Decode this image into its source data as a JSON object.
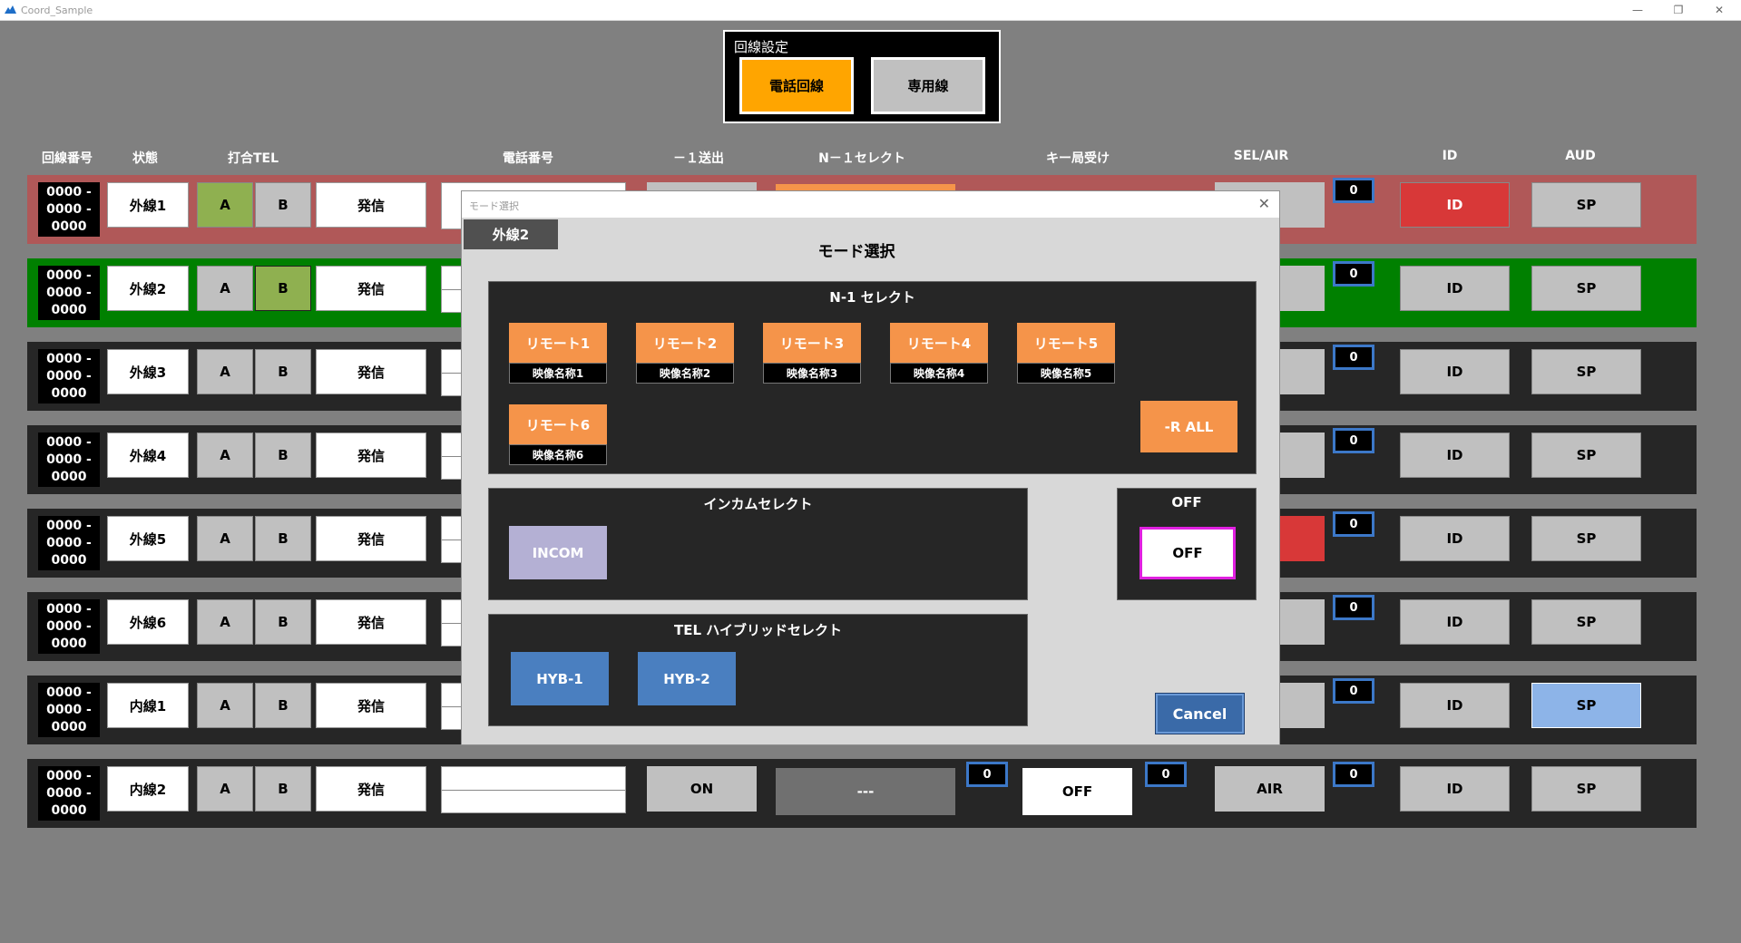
{
  "window": {
    "title": "Coord_Sample"
  },
  "line_setting": {
    "label": "回線設定",
    "phone_line": "電話回線",
    "dedicated_line": "専用線"
  },
  "columns": {
    "number": "回線番号",
    "status": "状態",
    "uchiawase": "打合TEL",
    "phone": "電話番号",
    "send": "－１送出",
    "n1": "N－１セレクト",
    "key": "キー局受け",
    "selair": "SEL/AIR",
    "id": "ID",
    "aud": "AUD"
  },
  "colors": {
    "row_selected": "#b05858",
    "row_active": "#008000",
    "row_default": "#262626",
    "accent_orange": "#ffa500"
  },
  "rows": [
    {
      "num": [
        "0000 -",
        "0000 -",
        "0000"
      ],
      "status": "外線1",
      "a": "A",
      "b": "B",
      "call": "発信",
      "id": "ID",
      "aud": "SP",
      "sq3": "0"
    },
    {
      "num": [
        "0000 -",
        "0000 -",
        "0000"
      ],
      "status": "外線2",
      "a": "A",
      "b": "B",
      "call": "発信",
      "id": "ID",
      "aud": "SP",
      "sq3": "0"
    },
    {
      "num": [
        "0000 -",
        "0000 -",
        "0000"
      ],
      "status": "外線3",
      "a": "A",
      "b": "B",
      "call": "発信",
      "id": "ID",
      "aud": "SP",
      "sq3": "0"
    },
    {
      "num": [
        "0000 -",
        "0000 -",
        "0000"
      ],
      "status": "外線4",
      "a": "A",
      "b": "B",
      "call": "発信",
      "id": "ID",
      "aud": "SP",
      "sq3": "0"
    },
    {
      "num": [
        "0000 -",
        "0000 -",
        "0000"
      ],
      "status": "外線5",
      "a": "A",
      "b": "B",
      "call": "発信",
      "id": "ID",
      "aud": "SP",
      "sq3": "0"
    },
    {
      "num": [
        "0000 -",
        "0000 -",
        "0000"
      ],
      "status": "外線6",
      "a": "A",
      "b": "B",
      "call": "発信",
      "id": "ID",
      "aud": "SP",
      "sq3": "0"
    },
    {
      "num": [
        "0000 -",
        "0000 -",
        "0000"
      ],
      "status": "内線1",
      "a": "A",
      "b": "B",
      "call": "発信",
      "id": "ID",
      "aud": "SP",
      "sq3": "0"
    },
    {
      "num": [
        "0000 -",
        "0000 -",
        "0000"
      ],
      "status": "内線2",
      "a": "A",
      "b": "B",
      "call": "発信",
      "send": "ON",
      "n1": "---",
      "sq1": "0",
      "key": "OFF",
      "sq2": "0",
      "selair": "AIR",
      "sq3": "0",
      "id": "ID",
      "aud": "SP"
    }
  ],
  "modal": {
    "window_title": "モード選択",
    "line_tag": "外線2",
    "heading": "モード選択",
    "n1_title": "N-1  セレクト",
    "remotes": [
      {
        "label": "リモート1",
        "video": "映像名称1"
      },
      {
        "label": "リモート2",
        "video": "映像名称2"
      },
      {
        "label": "リモート3",
        "video": "映像名称3"
      },
      {
        "label": "リモート4",
        "video": "映像名称4"
      },
      {
        "label": "リモート5",
        "video": "映像名称5"
      },
      {
        "label": "リモート6",
        "video": "映像名称6"
      }
    ],
    "r_all": "-R ALL",
    "intercom_title": "インカムセレクト",
    "incom": "INCOM",
    "off_title": "OFF",
    "off_button": "OFF",
    "tel_title": "TEL ハイブリッドセレクト",
    "hyb1": "HYB-1",
    "hyb2": "HYB-2",
    "cancel": "Cancel"
  }
}
